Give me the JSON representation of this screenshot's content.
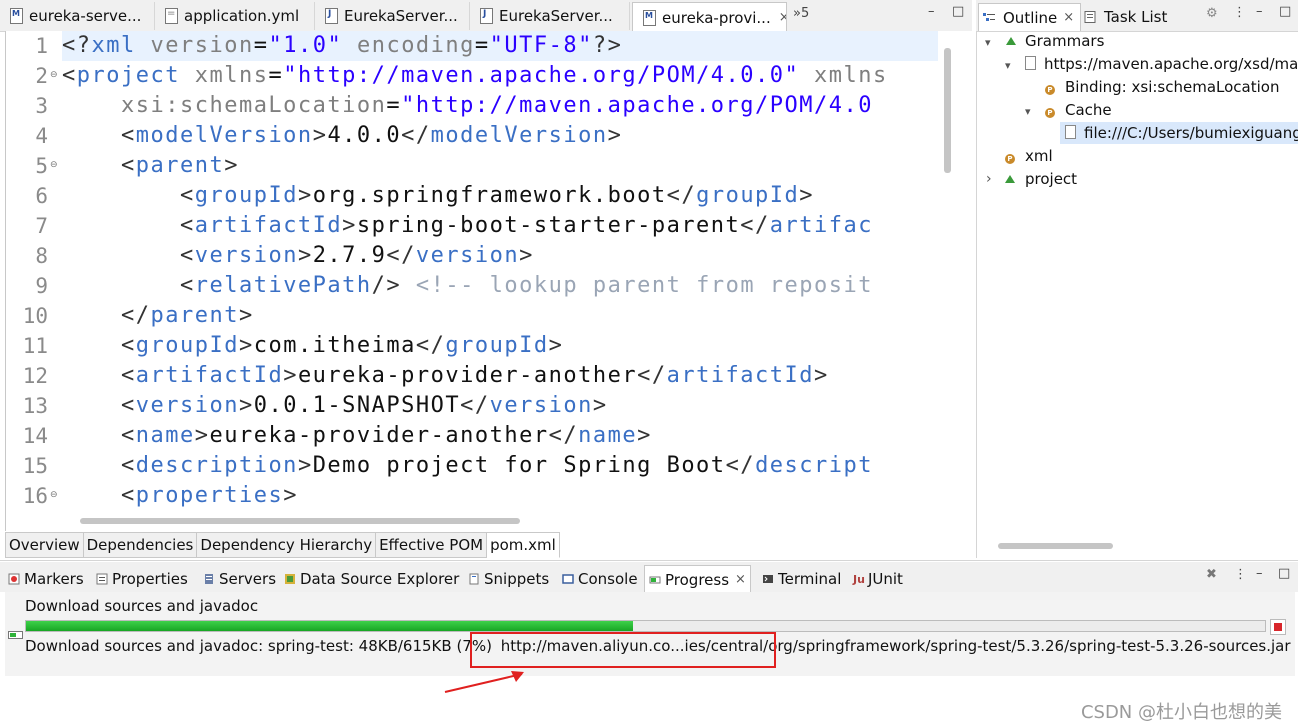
{
  "editor_tabs": [
    {
      "label": "eureka-serve...",
      "icon": "maven-pom-icon",
      "active": false
    },
    {
      "label": "application.yml",
      "icon": "yaml-file-icon",
      "active": false
    },
    {
      "label": "EurekaServer...",
      "icon": "java-file-icon",
      "active": false
    },
    {
      "label": "EurekaServer...",
      "icon": "java-file-icon",
      "active": false
    },
    {
      "label": "eureka-provi...",
      "icon": "maven-pom-icon",
      "active": true,
      "close": "×"
    }
  ],
  "overflow_label": "»5",
  "window_controls": {
    "minimize": "–",
    "maximize": "□"
  },
  "code_lines": [
    {
      "n": "1",
      "text": "<?xml version=\"1.0\" encoding=\"UTF-8\"?>"
    },
    {
      "n": "2",
      "text": "<project xmlns=\"http://maven.apache.org/POM/4.0.0\" xmlns"
    },
    {
      "n": "3",
      "text": "    xsi:schemaLocation=\"http://maven.apache.org/POM/4.0"
    },
    {
      "n": "4",
      "text": "    <modelVersion>4.0.0</modelVersion>"
    },
    {
      "n": "5",
      "text": "    <parent>"
    },
    {
      "n": "6",
      "text": "        <groupId>org.springframework.boot</groupId>"
    },
    {
      "n": "7",
      "text": "        <artifactId>spring-boot-starter-parent</artifac"
    },
    {
      "n": "8",
      "text": "        <version>2.7.9</version>"
    },
    {
      "n": "9",
      "text": "        <relativePath/> <!-- lookup parent from reposit"
    },
    {
      "n": "10",
      "text": "    </parent>"
    },
    {
      "n": "11",
      "text": "    <groupId>com.itheima</groupId>"
    },
    {
      "n": "12",
      "text": "    <artifactId>eureka-provider-another</artifactId>"
    },
    {
      "n": "13",
      "text": "    <version>0.0.1-SNAPSHOT</version>"
    },
    {
      "n": "14",
      "text": "    <name>eureka-provider-another</name>"
    },
    {
      "n": "15",
      "text": "    <description>Demo project for Spring Boot</descript"
    },
    {
      "n": "16",
      "text": "    <properties>"
    }
  ],
  "fold_glyph": "⊖",
  "pom_tabs": [
    "Overview",
    "Dependencies",
    "Dependency Hierarchy",
    "Effective POM",
    "pom.xml"
  ],
  "pom_active": "pom.xml",
  "outline": {
    "tabs": [
      {
        "label": "Outline",
        "active": true,
        "close": "×"
      },
      {
        "label": "Task List",
        "active": false
      }
    ],
    "tree": [
      {
        "label": "Grammars",
        "twisty": "▾"
      },
      {
        "label": "https://maven.apache.org/xsd/maven",
        "twisty": "▾"
      },
      {
        "label": "Binding: xsi:schemaLocation",
        "twisty": ""
      },
      {
        "label": "Cache",
        "twisty": "▾"
      },
      {
        "label": "file:///C:/Users/bumiexiguang",
        "twisty": ""
      },
      {
        "label": "xml",
        "twisty": ""
      },
      {
        "label": "project",
        "twisty": "›"
      }
    ]
  },
  "bottom_tabs": [
    {
      "label": "Markers",
      "active": false
    },
    {
      "label": "Properties",
      "active": false
    },
    {
      "label": "Servers",
      "active": false
    },
    {
      "label": "Data Source Explorer",
      "active": false
    },
    {
      "label": "Snippets",
      "active": false
    },
    {
      "label": "Console",
      "active": false
    },
    {
      "label": "Progress",
      "active": true,
      "close": "×"
    },
    {
      "label": "Terminal",
      "active": false
    },
    {
      "label": "JUnit",
      "active": false
    }
  ],
  "progress": {
    "title": "Download sources and javadoc",
    "percent": 49,
    "status_prefix": "Download sources and javadoc: spring-test: 48KB/615KB (7%)",
    "url_short": "http://maven.aliyun.co...ies/central/org/",
    "url_rest": "springframework/spring-test/5.3.26/spring-test-5.3.26-sources.jar"
  },
  "annotation_color": "#e0201f",
  "watermark": "CSDN @杜小白也想的美"
}
